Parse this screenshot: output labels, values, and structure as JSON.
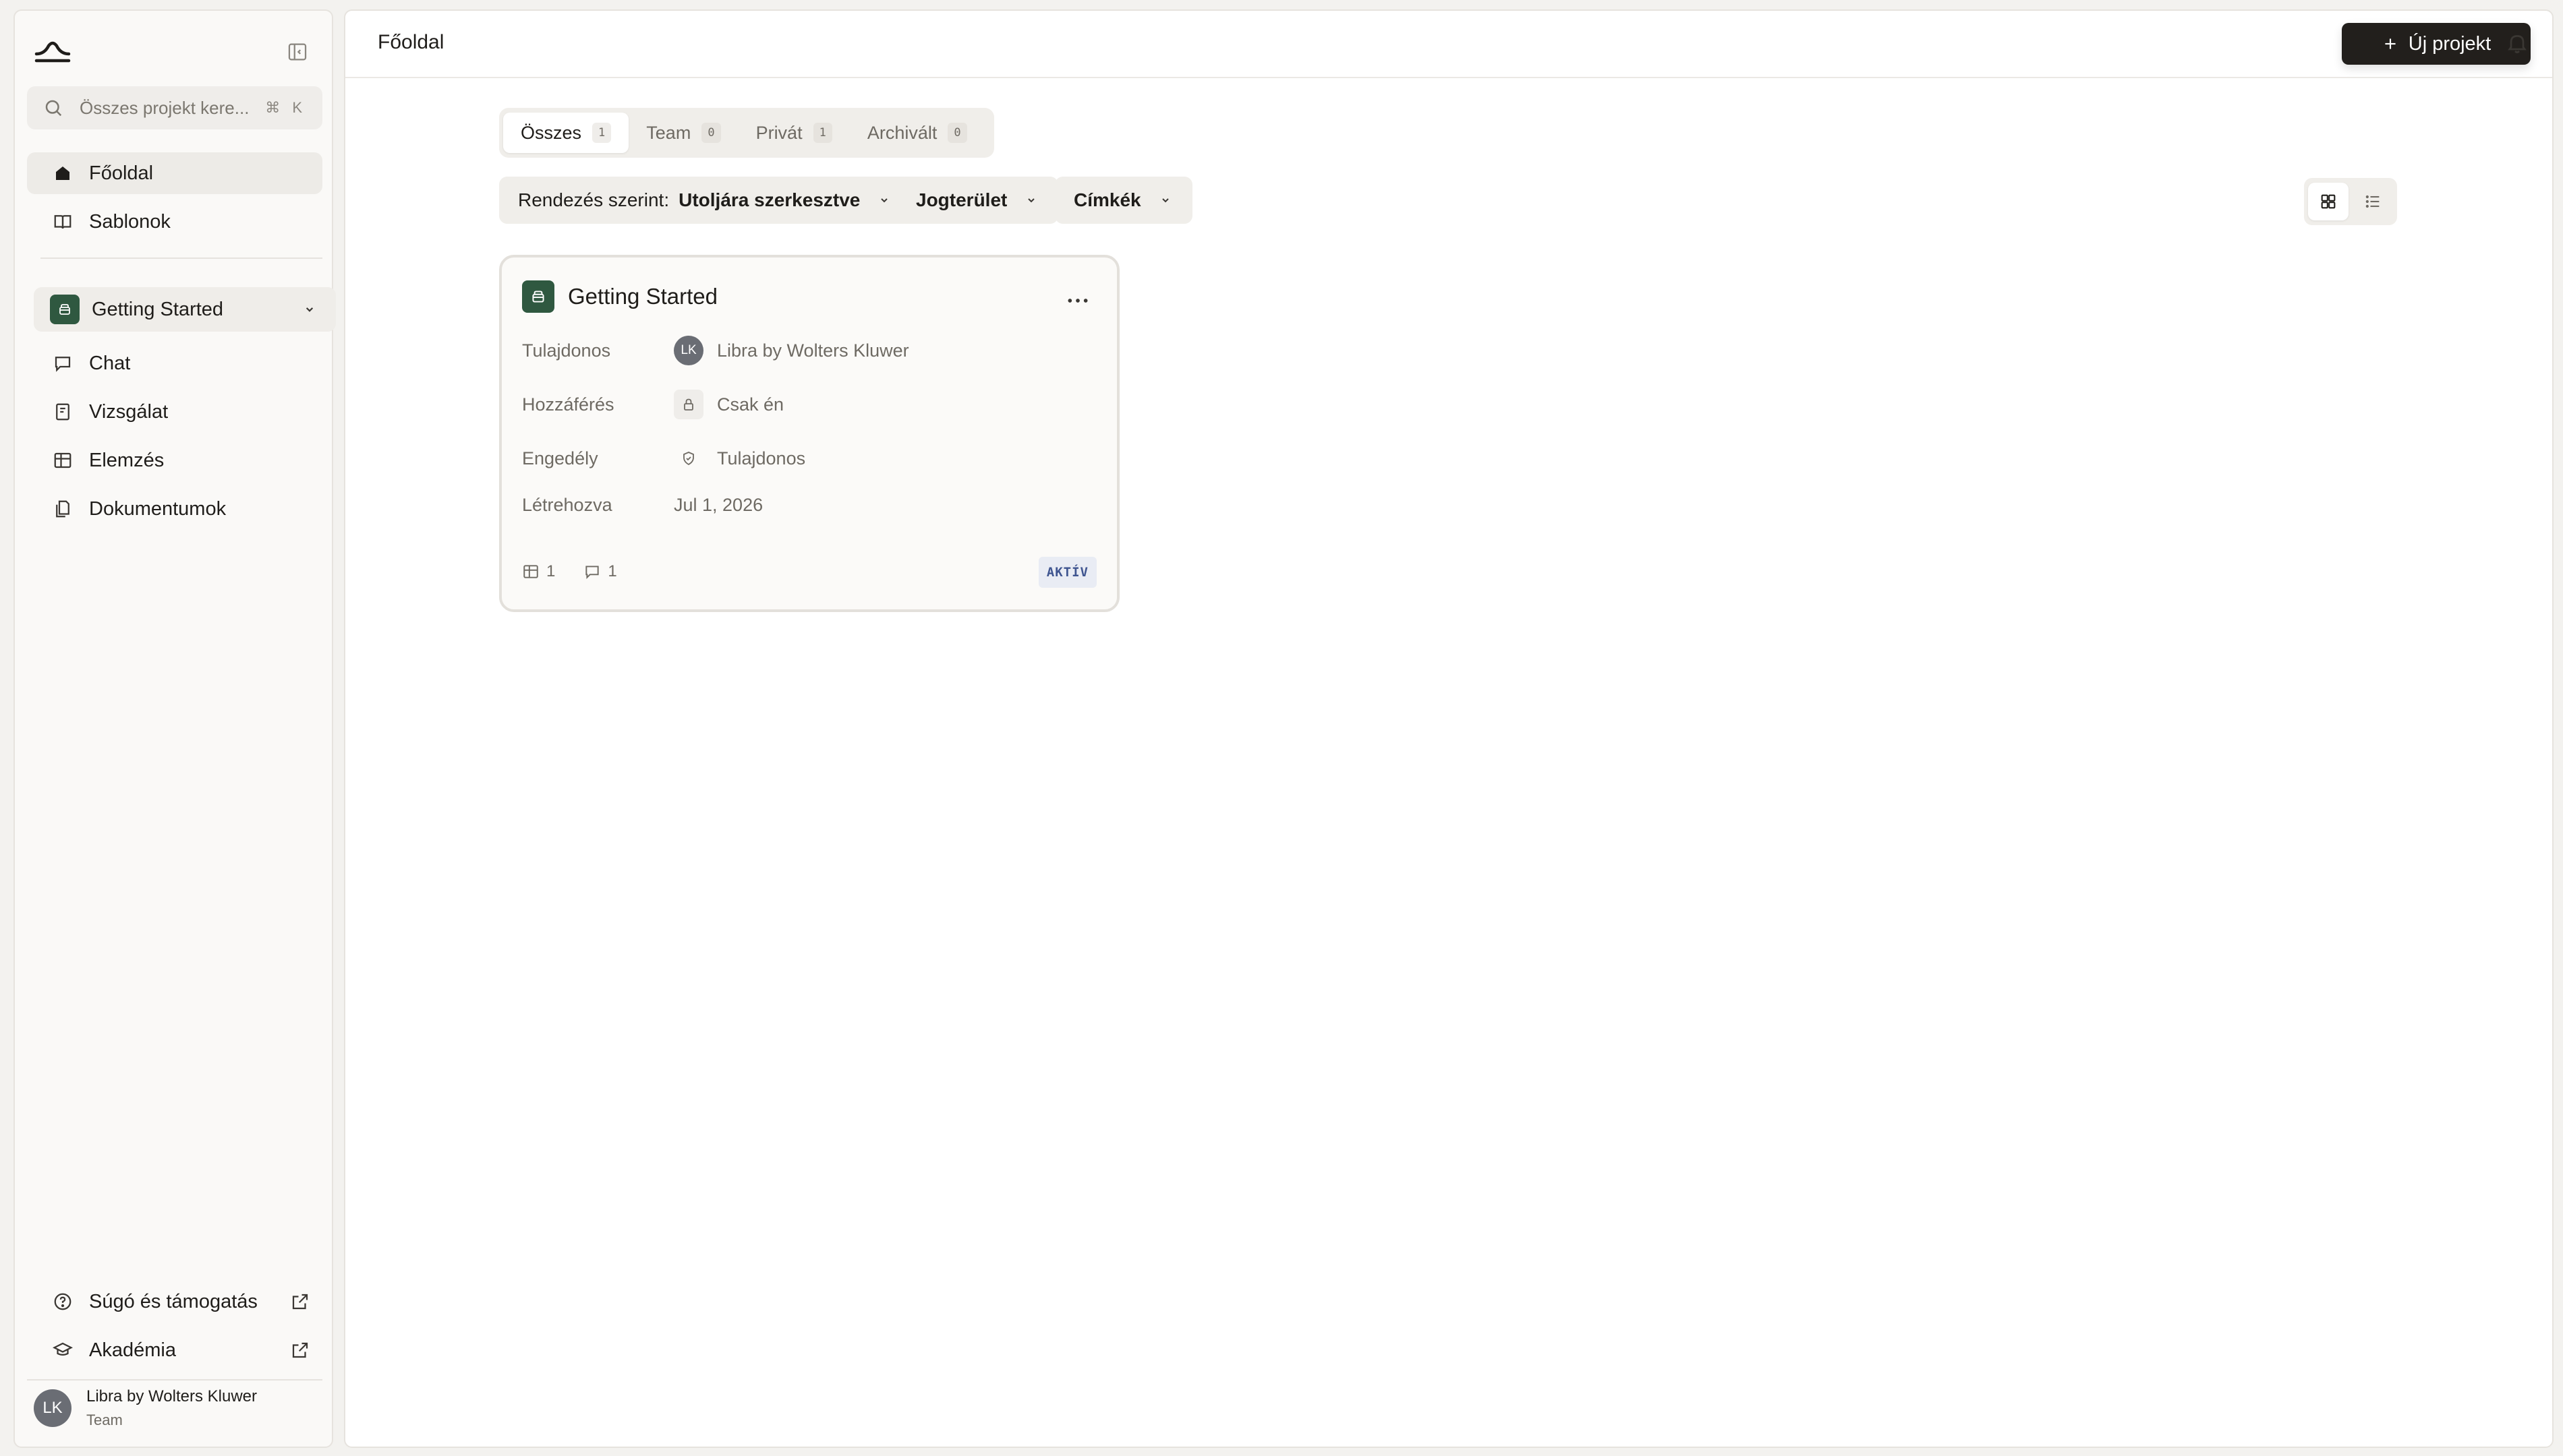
{
  "sidebar": {
    "search_placeholder": "Összes projekt kere...",
    "search_shortcut": "⌘ K",
    "nav": [
      {
        "label": "Főoldal",
        "icon": "home-icon"
      },
      {
        "label": "Sablonok",
        "icon": "book-icon"
      }
    ],
    "project": {
      "name": "Getting Started",
      "badge_color": "#2f5840"
    },
    "project_nav": [
      {
        "label": "Chat",
        "icon": "chat-icon"
      },
      {
        "label": "Vizsgálat",
        "icon": "review-icon"
      },
      {
        "label": "Elemzés",
        "icon": "table-icon"
      },
      {
        "label": "Dokumentumok",
        "icon": "documents-icon"
      }
    ],
    "bottom_links": [
      {
        "label": "Súgó és támogatás",
        "icon": "help-icon"
      },
      {
        "label": "Akadémia",
        "icon": "academy-icon"
      }
    ],
    "user": {
      "initials": "LK",
      "name": "Libra by Wolters Kluwer",
      "team": "Team"
    }
  },
  "header": {
    "title": "Főoldal",
    "new_project_label": "Új projekt"
  },
  "tabs": [
    {
      "label": "Összes",
      "count": "1",
      "active": true
    },
    {
      "label": "Team",
      "count": "0",
      "active": false
    },
    {
      "label": "Privát",
      "count": "1",
      "active": false
    },
    {
      "label": "Archivált",
      "count": "0",
      "active": false
    }
  ],
  "filters": {
    "sort_prefix": "Rendezés szerint:",
    "sort_value": "Utoljára szerkesztve",
    "jurisdiction": "Jogterület",
    "tags": "Címkék"
  },
  "card": {
    "title": "Getting Started",
    "owner_label": "Tulajdonos",
    "owner_initials": "LK",
    "owner_value": "Libra by Wolters Kluwer",
    "access_label": "Hozzáférés",
    "access_value": "Csak én",
    "permission_label": "Engedély",
    "permission_value": "Tulajdonos",
    "created_label": "Létrehozva",
    "created_value": "Jul 1, 2026",
    "table_count": "1",
    "chat_count": "1",
    "status": "AKTÍV"
  },
  "colors": {
    "accent_dark": "#221f1c",
    "project_green": "#2f5840",
    "status_blue": "#3f5590"
  }
}
